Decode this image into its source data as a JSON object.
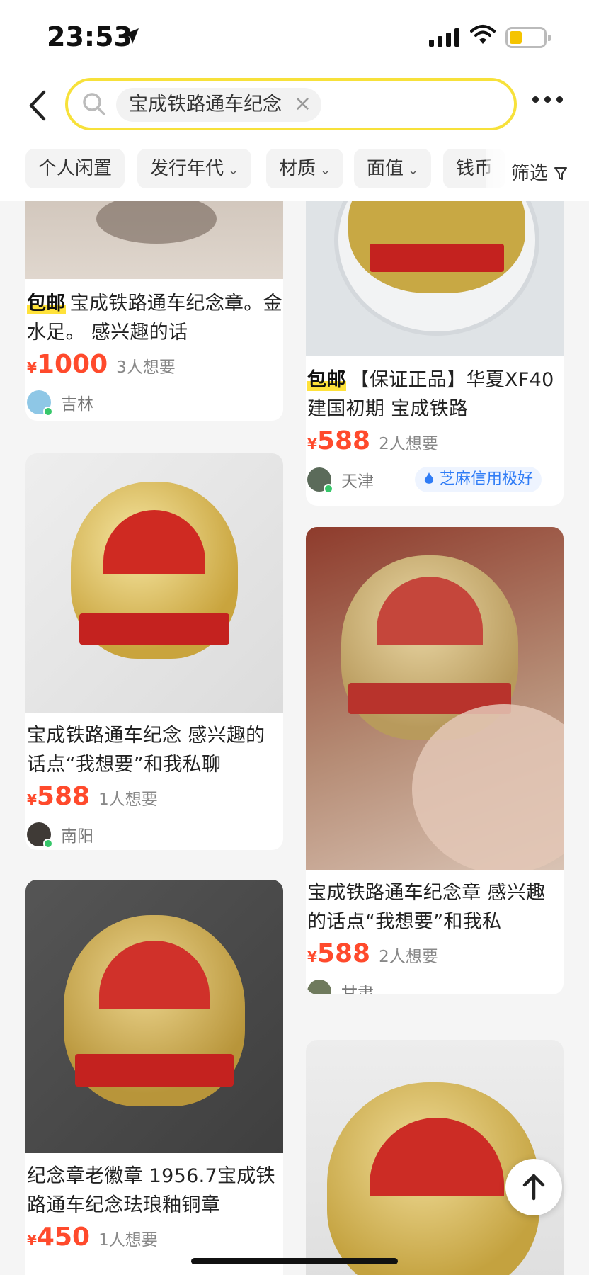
{
  "status": {
    "time": "23:53"
  },
  "search": {
    "query": "宝成铁路通车纪念"
  },
  "filters": {
    "chips": [
      {
        "label": "个人闲置",
        "dropdown": false
      },
      {
        "label": "发行年代",
        "dropdown": true
      },
      {
        "label": "材质",
        "dropdown": true
      },
      {
        "label": "面值",
        "dropdown": true
      },
      {
        "label": "钱币",
        "dropdown": false
      }
    ],
    "filter_button": "筛选"
  },
  "listings": [
    {
      "free_ship": "包邮",
      "title": "宝成铁路通车纪念章。金水足。 感兴趣的话",
      "yen": "¥",
      "price": "1000",
      "wants": "3人想要",
      "location": "吉林"
    },
    {
      "free_ship": "包邮",
      "title": "【保证正品】华夏XF40 建国初期 宝成铁路",
      "yen": "¥",
      "price": "588",
      "wants": "2人想要",
      "location": "天津",
      "credit_badge": "芝麻信用极好"
    },
    {
      "title": "宝成铁路通车纪念 感兴趣的话点“我想要”和我私聊",
      "yen": "¥",
      "price": "588",
      "wants": "1人想要",
      "location": "南阳"
    },
    {
      "title": "宝成铁路通车纪念章 感兴趣的话点“我想要”和我私",
      "yen": "¥",
      "price": "588",
      "wants": "2人想要",
      "location": "甘肃"
    },
    {
      "title": "纪念章老徽章 1956.7宝成铁路通车纪念珐琅釉铜章",
      "yen": "¥",
      "price": "450",
      "wants": "1人想要"
    }
  ],
  "colors": {
    "accent_yellow": "#f7e13a",
    "price_red": "#ff4a2c",
    "credit_blue": "#2f7cf6"
  }
}
